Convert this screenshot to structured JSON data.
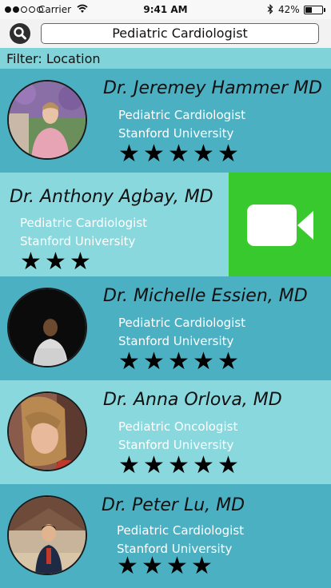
{
  "status_bar": {
    "signal": [
      true,
      true,
      false,
      false,
      false
    ],
    "carrier": "Carrier",
    "time": "9:41 AM",
    "battery_pct": "42%",
    "battery_level": 0.42
  },
  "search": {
    "query": "Pediatric Cardiologist",
    "icon": "search-icon"
  },
  "filter": {
    "label": "Filter: Location"
  },
  "doctors": [
    {
      "name": "Dr. Jeremey Hammer MD",
      "specialty": "Pediatric Cardiologist",
      "institution": "Stanford University",
      "rating": 5,
      "stars": "★★★★★"
    },
    {
      "name": "Dr. Anthony Agbay, MD",
      "specialty": "Pediatric Cardiologist",
      "institution": "Stanford University",
      "rating": 3,
      "stars": "★★★",
      "action_icon": "video-camera-icon"
    },
    {
      "name": "Dr. Michelle Essien, MD",
      "specialty": "Pediatric Cardiologist",
      "institution": "Stanford University",
      "rating": 5,
      "stars": "★★★★★"
    },
    {
      "name": "Dr. Anna Orlova, MD",
      "specialty": "Pediatric Oncologist",
      "institution": "Stanford University",
      "rating": 5,
      "stars": "★★★★★"
    },
    {
      "name": "Dr. Peter Lu, MD",
      "specialty": "Pediatric Cardiologist",
      "institution": "Stanford University",
      "rating": 4,
      "stars": "★★★★"
    }
  ],
  "colors": {
    "row_dark": "#4cb0c3",
    "row_light": "#89d8dd",
    "filter_bar": "#80d3d8",
    "video_green": "#38c92e",
    "sub_text": "#ffffff"
  }
}
